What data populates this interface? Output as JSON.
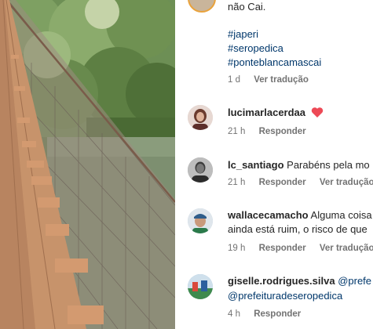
{
  "caption": {
    "tail_text": "não Cai.",
    "hashtags": [
      "#japeri",
      "#seropedica",
      "#ponteblancamascai"
    ],
    "time": "1 d",
    "translation": "Ver tradução"
  },
  "comments": [
    {
      "user": "lucimarlacerdaa",
      "text": "",
      "emoji": "red-heart",
      "time": "21 h",
      "reply": "Responder",
      "translation": ""
    },
    {
      "user": "lc_santiago",
      "text": "Parabéns pela mo",
      "time": "21 h",
      "reply": "Responder",
      "translation": "Ver tradução"
    },
    {
      "user": "wallacecamacho",
      "text": "Alguma coisa",
      "text_line2": "ainda está ruim, o risco de que",
      "time": "19 h",
      "reply": "Responder",
      "translation": "Ver tradução"
    },
    {
      "user": "giselle.rodrigues.silva",
      "mention": "@prefe",
      "mention_line2": "@prefeituradeseropedica",
      "time": "4 h",
      "reply": "Responder",
      "translation": ""
    }
  ],
  "colors": {
    "link": "#00376b",
    "secondary_text": "#737373",
    "heart": "#ed4956"
  }
}
